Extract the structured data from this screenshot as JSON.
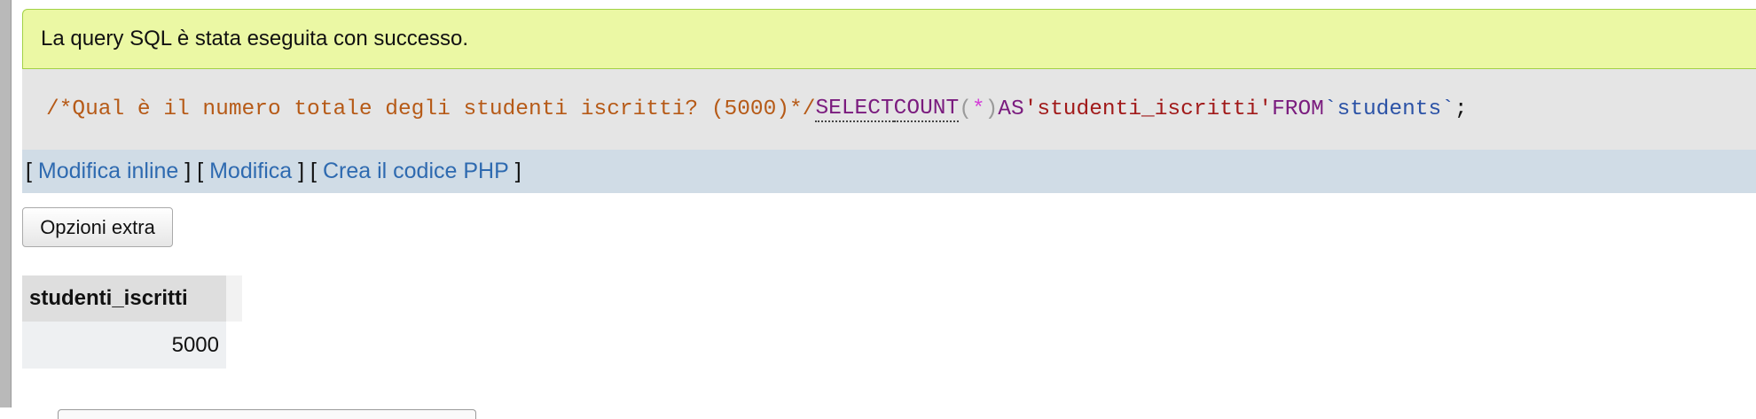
{
  "message": {
    "success_text": "La query SQL è stata eseguita con successo."
  },
  "sql": {
    "comment": "/*Qual è il numero totale degli studenti iscritti? (5000)*/",
    "select": "SELECT",
    "count": "COUNT",
    "paren_open": "(",
    "star": "*",
    "paren_close": ")",
    "as": "AS",
    "alias": "'studenti_iscritti'",
    "from": "FROM",
    "table": "`students`",
    "semicolon": ";"
  },
  "links": {
    "bracket_open": "[",
    "bracket_close": "]",
    "edit_inline": "Modifica inline",
    "edit": "Modifica",
    "create_php": "Crea il codice PHP"
  },
  "options": {
    "extra_label": "Opzioni extra"
  },
  "result": {
    "columns": [
      "studenti_iscritti"
    ],
    "rows": [
      [
        "5000"
      ]
    ]
  },
  "colors": {
    "success_bg": "#ebf8a4",
    "sql_bg": "#e5e5e5",
    "links_bg": "#d0dce6",
    "link": "#2e6ab0"
  }
}
